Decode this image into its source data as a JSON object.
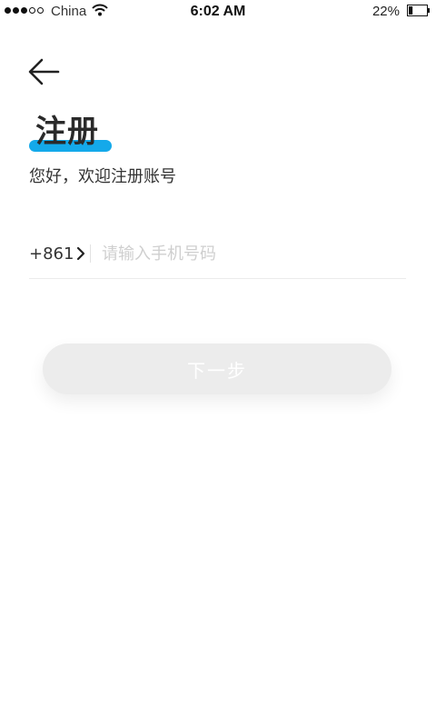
{
  "status_bar": {
    "carrier": "China",
    "time": "6:02 AM",
    "battery_percent": "22%",
    "battery_level": 0.22,
    "signal_bars": 3,
    "signal_total": 5
  },
  "icons": {
    "back": "arrow-left-icon",
    "chevron": "chevron-right-icon",
    "wifi": "wifi-icon",
    "battery": "battery-icon"
  },
  "page": {
    "title": "注册",
    "subtitle": "您好，欢迎注册账号"
  },
  "form": {
    "country_code": "+861",
    "phone_placeholder": "请输入手机号码",
    "phone_value": ""
  },
  "actions": {
    "next_label": "下一步"
  },
  "colors": {
    "accent": "#14a9ea",
    "button_disabled": "#ececec",
    "placeholder": "#cfcfcf"
  }
}
